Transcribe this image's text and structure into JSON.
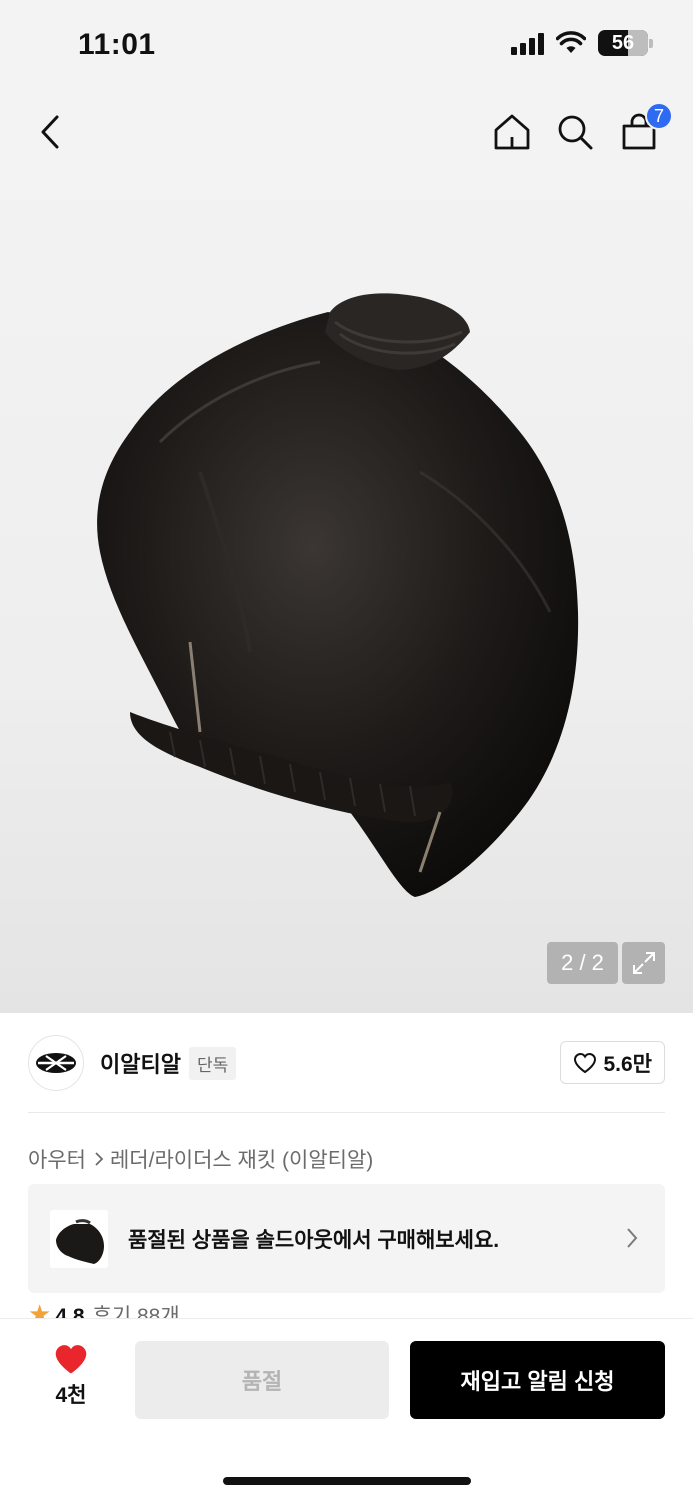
{
  "status_bar": {
    "time": "11:01",
    "battery": "56"
  },
  "top_nav": {
    "cart_count": "7"
  },
  "gallery": {
    "page_indicator": "2 / 2"
  },
  "brand": {
    "name": "이알티알",
    "badge": "단독",
    "likes": "5.6만"
  },
  "breadcrumb": {
    "category": "아우터",
    "subcategory": "레더/라이더스 재킷 (이알티알)"
  },
  "soldout_banner": {
    "text": "품절된 상품을 솔드아웃에서 구매해보세요."
  },
  "rating": {
    "score": "4.8",
    "reviews": "후기 88개"
  },
  "bottom_bar": {
    "wish_count": "4천",
    "soldout_label": "품절",
    "restock_label": "재입고 알림 신청"
  },
  "colors": {
    "accent_blue": "#2f6bf2",
    "heart_red": "#e8262b",
    "primary_black": "#000000",
    "star": "#f2a23a"
  }
}
